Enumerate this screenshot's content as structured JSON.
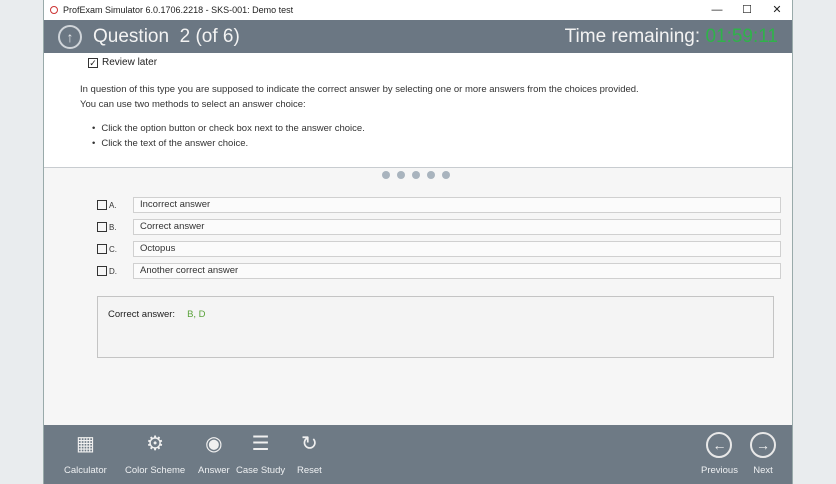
{
  "window": {
    "title": "ProfExam Simulator 6.0.1706.2218 - SKS-001: Demo test",
    "controls": [
      "—",
      "☐",
      "✕"
    ]
  },
  "header": {
    "question_label": "Question",
    "question_number": "2",
    "question_of": "(of 6)",
    "time_label": "Time remaining:",
    "time_value": "01:59:11"
  },
  "review_later": {
    "label": "Review later",
    "checked": true
  },
  "instructions": {
    "line1": "In question of this type you are supposed to  indicate the correct answer by selecting one or more answers from the choices provided.",
    "line2": "You can use two methods to select an answer choice:",
    "bullets": [
      "Click the option button or check box next to the answer choice.",
      "Click the text of the answer choice."
    ]
  },
  "pager": {
    "dots": 5
  },
  "options": [
    {
      "letter": "A.",
      "text": "Incorrect answer",
      "checked": false
    },
    {
      "letter": "B.",
      "text": "Correct answer",
      "checked": false
    },
    {
      "letter": "C.",
      "text": "Octopus",
      "checked": false
    },
    {
      "letter": "D.",
      "text": "Another correct answer",
      "checked": false
    }
  ],
  "answer": {
    "label": "Correct answer:",
    "value": "B, D"
  },
  "footer": {
    "calculator": "Calculator",
    "color_scheme": "Color Scheme",
    "answer": "Answer",
    "case_study": "Case Study",
    "reset": "Reset",
    "previous": "Previous",
    "next": "Next"
  },
  "colors": {
    "header": "#6b7783",
    "timer": "#2fb34a",
    "answer_value": "#5aa23a"
  }
}
